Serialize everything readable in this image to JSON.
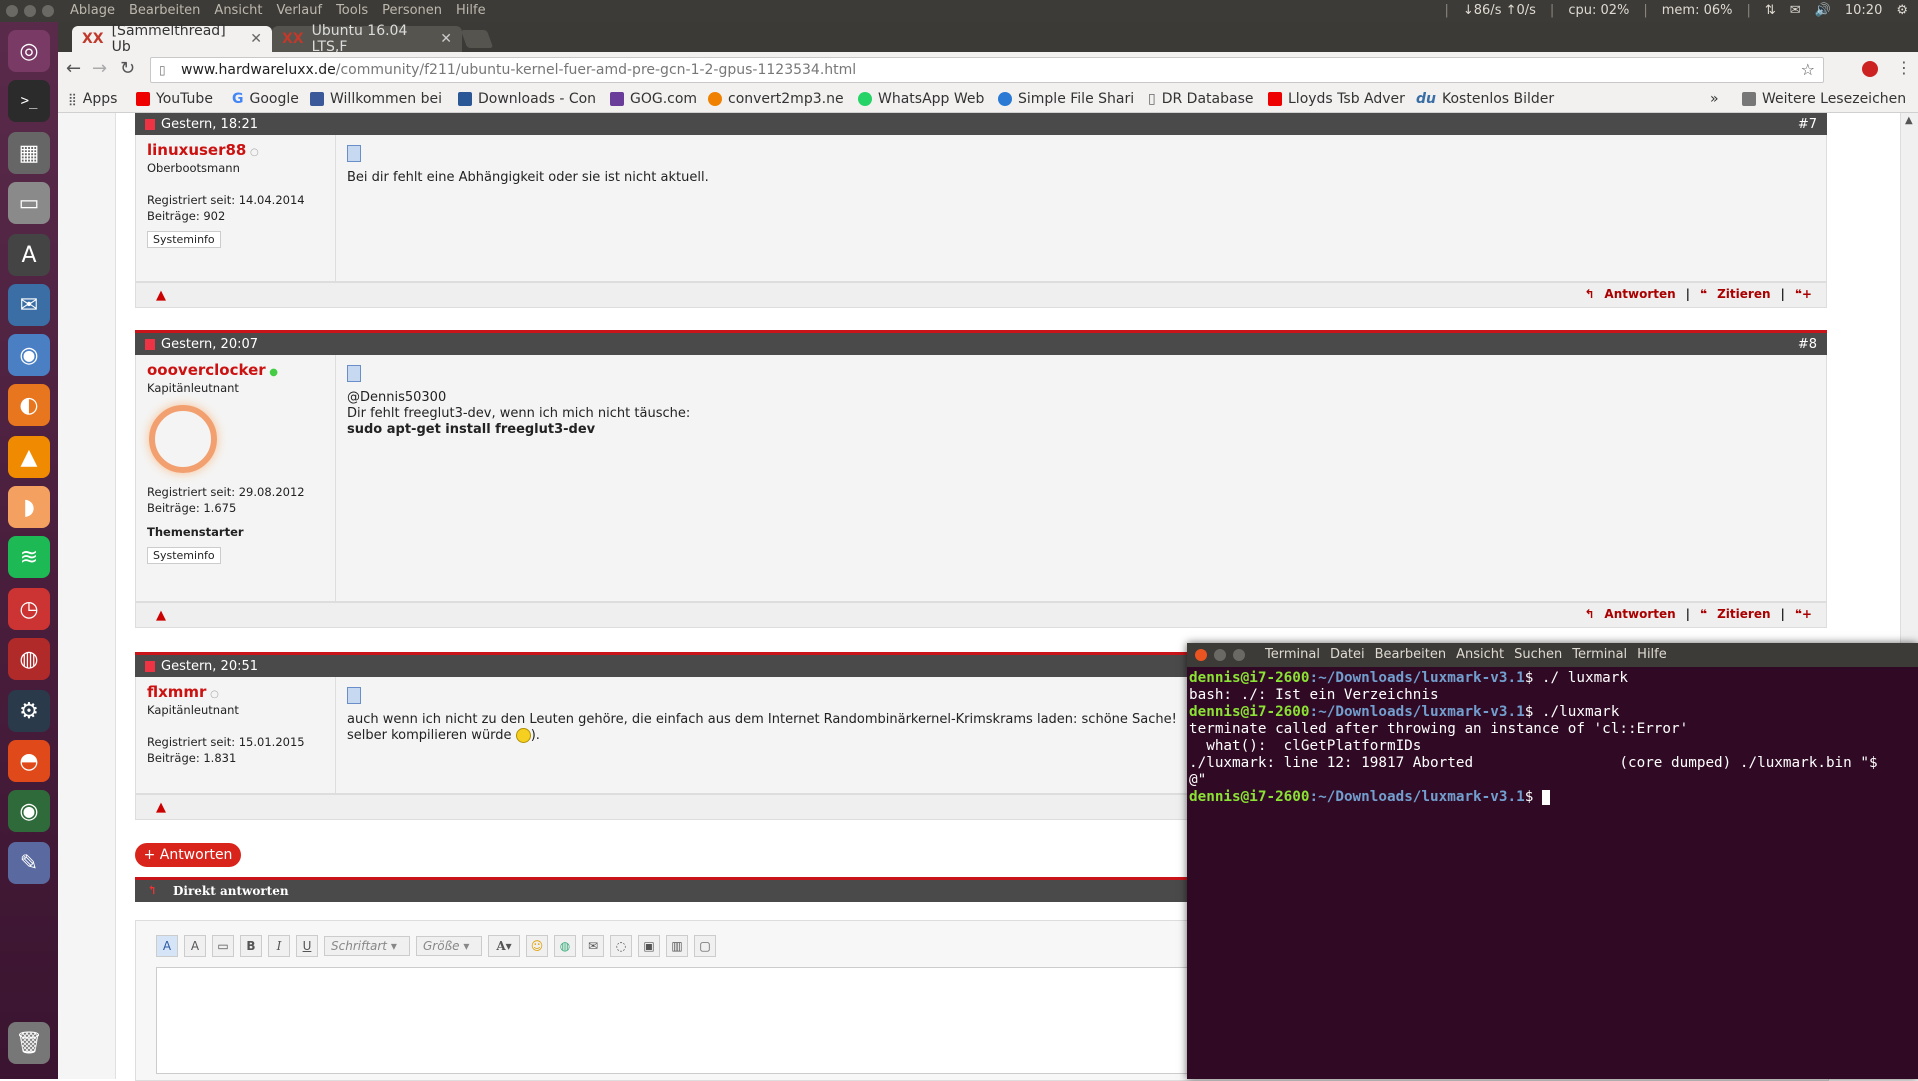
{
  "topbar": {
    "menu": [
      "Ablage",
      "Bearbeiten",
      "Ansicht",
      "Verlauf",
      "Tools",
      "Personen",
      "Hilfe"
    ],
    "net": "↓86/s ↑0/s",
    "cpu": "cpu: 02%",
    "mem": "mem: 06%",
    "clock": "10:20"
  },
  "browser": {
    "tabs": [
      {
        "label": "[Sammelthread] Ub",
        "active": true
      },
      {
        "label": "Ubuntu 16.04 LTS,F",
        "active": false
      }
    ],
    "url_host": "www.hardwareluxx.de",
    "url_path": "/community/f211/ubuntu-kernel-fuer-amd-pre-gcn-1-2-gpus-1123534.html",
    "bookmarks": [
      "Apps",
      "YouTube",
      "Google",
      "Willkommen bei",
      "Downloads - Con",
      "GOG.com",
      "convert2mp3.ne",
      "WhatsApp Web",
      "Simple File Shari",
      "DR Database",
      "Lloyds Tsb Adver",
      "Kostenlos Bilder"
    ],
    "bookmarks_more": "»",
    "other_bookmarks": "Weitere Lesezeichen"
  },
  "posts": [
    {
      "date": "Gestern, 18:21",
      "num": "#7",
      "user": "linuxuser88",
      "rank": "Oberbootsmann",
      "registered": "Registriert seit: 14.04.2014",
      "posts": "Beiträge: 902",
      "sysinfo": "Systeminfo",
      "lines": [
        "Bei dir fehlt eine Abhängigkeit oder sie ist nicht aktuell."
      ]
    },
    {
      "date": "Gestern, 20:07",
      "num": "#8",
      "user": "oooverclocker",
      "rank": "Kapitänleutnant",
      "registered": "Registriert seit: 29.08.2012",
      "posts": "Beiträge: 1.675",
      "starter": "Themenstarter",
      "sysinfo": "Systeminfo",
      "lines": [
        "@Dennis50300",
        "Dir fehlt freeglut3-dev, wenn ich mich nicht täusche:"
      ],
      "bold_line": "sudo apt-get install freeglut3-dev"
    },
    {
      "date": "Gestern, 20:51",
      "user": "flxmmr",
      "rank": "Kapitänleutnant",
      "registered": "Registriert seit: 15.01.2015",
      "posts": "Beiträge: 1.831",
      "lines": [
        "auch wenn ich nicht zu den Leuten gehöre, die einfach aus dem Internet Randombinärkernel-Krimskrams laden: schöne Sache!",
        "selber kompilieren würde"
      ],
      "line_end": ")."
    }
  ],
  "actions": {
    "reply": "Antworten",
    "quote": "Zitieren"
  },
  "reply_button": "+ Antworten",
  "direct_reply": "Direkt antworten",
  "editor": {
    "font": "Schriftart",
    "size": "Größe"
  },
  "terminal": {
    "menu": [
      "Terminal",
      "Datei",
      "Bearbeiten",
      "Ansicht",
      "Suchen",
      "Terminal",
      "Hilfe"
    ],
    "prompt_user": "dennis@i7-2600",
    "prompt_path": ":~/Downloads/luxmark-v3.1",
    "prompt_end": "$ ",
    "cmd1": "./ luxmark",
    "out1": "bash: ./: Ist ein Verzeichnis",
    "cmd2": "./luxmark",
    "out2": "terminate called after throwing an instance of 'cl::Error'",
    "out3": "  what():  clGetPlatformIDs",
    "out4": "./luxmark: line 12: 19817 Aborted                 (core dumped) ./luxmark.bin \"$",
    "out5": "@\""
  }
}
